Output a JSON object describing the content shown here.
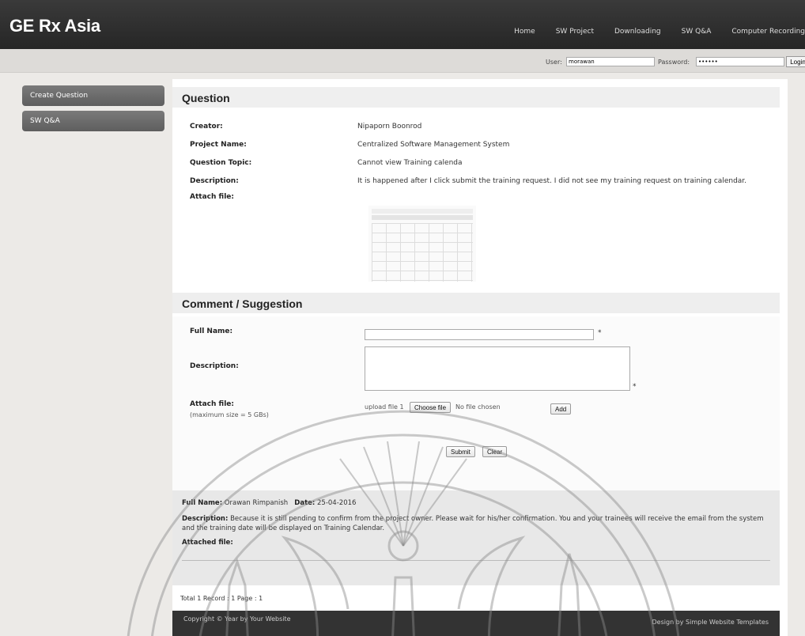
{
  "header": {
    "brand": "GE Rx Asia",
    "nav": [
      "Home",
      "SW Project",
      "Downloading",
      "SW Q&A",
      "Computer Recording"
    ]
  },
  "login": {
    "user_label": "User:",
    "user_value": "morawan",
    "password_label": "Password:",
    "password_value": "••••••",
    "login_button": "Login"
  },
  "sidebar": {
    "items": [
      {
        "label": "Create Question"
      },
      {
        "label": "SW Q&A"
      }
    ]
  },
  "question": {
    "heading": "Question",
    "fields": [
      {
        "key": "Creator:",
        "value": "Nipaporn Boonrod"
      },
      {
        "key": "Project Name:",
        "value": "Centralized Software Management System"
      },
      {
        "key": "Question Topic:",
        "value": "Cannot view Training calenda"
      },
      {
        "key": "Description:",
        "value": "It is happened after I click submit the training request. I did not see my training request on training calendar."
      },
      {
        "key": "Attach file:",
        "value": ""
      }
    ]
  },
  "comment": {
    "heading": "Comment / Suggestion",
    "full_name_label": "Full Name:",
    "full_name_value": "",
    "description_label": "Description:",
    "description_value": "",
    "required_mark": "*",
    "attach_label": "Attach file:",
    "attach_note": "(maximum size = 5 GBs)",
    "upload_label": "upload file 1",
    "choose_file_button": "Choose file",
    "no_file_text": "No file chosen",
    "add_button": "Add",
    "submit_button": "Submit",
    "clear_button": "Clear"
  },
  "entries": [
    {
      "full_name_label": "Full Name:",
      "full_name": "Orawan Rimpanish",
      "date_label": "Date:",
      "date": "25-04-2016",
      "description_label": "Description:",
      "description": "Because it is still pending to confirm from the project owner. Please wait for his/her confirmation. You and your trainees will receive the email from the system and the training date will be displayed on Training Calendar.",
      "attached_label": "Attached file:"
    }
  ],
  "pagination": {
    "text": "Total 1 Record : 1 Page : 1"
  },
  "footer": {
    "left": "Copyright © Year by Your Website",
    "right": "Design by Simple Website Templates"
  }
}
